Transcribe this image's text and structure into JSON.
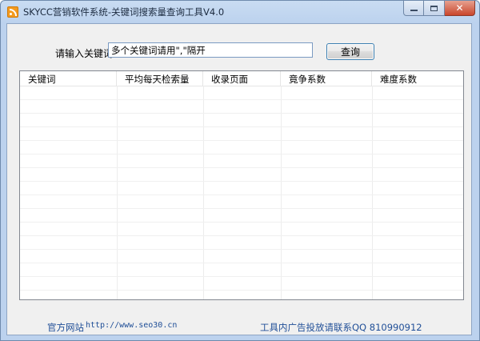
{
  "window": {
    "title": "SKYCC营销软件系统-关键词搜索量查询工具V4.0"
  },
  "search": {
    "label": "请输入关键词",
    "value": "多个关键词请用\",\"隔开",
    "button_label": "查询"
  },
  "table": {
    "columns": [
      "关键词",
      "平均每天检索量",
      "收录页面",
      "竟争系数",
      "难度系数"
    ],
    "rows": []
  },
  "footer": {
    "site_label": "官方网站",
    "site_url": "http://www.seo30.cn",
    "ad_text": "工具内广告投放请联系QQ 810990912"
  }
}
